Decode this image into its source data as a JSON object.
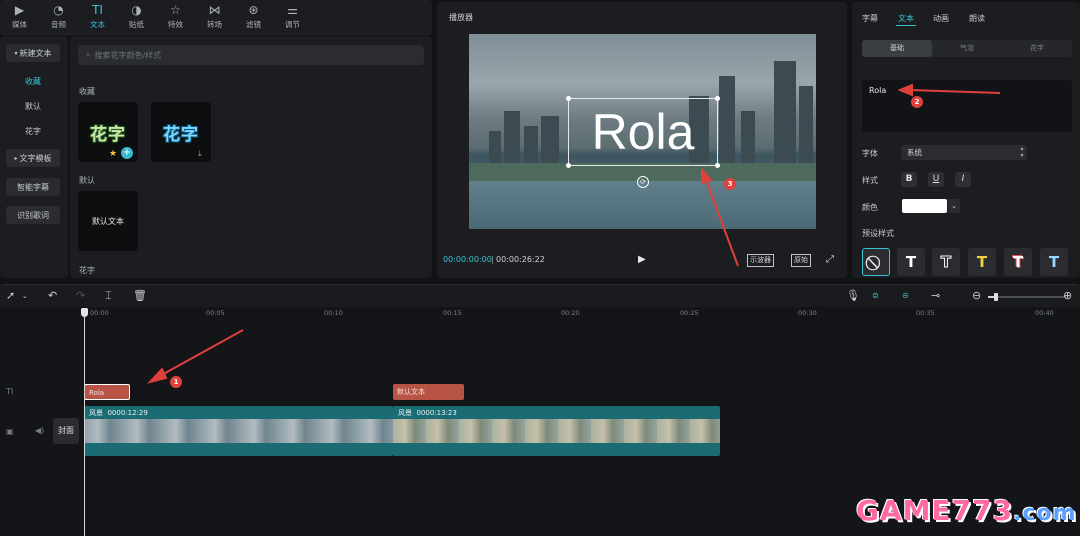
{
  "toolbar": {
    "items": [
      {
        "label": "媒体",
        "icon": "media-icon"
      },
      {
        "label": "音频",
        "icon": "audio-icon"
      },
      {
        "label": "文本",
        "icon": "text-icon"
      },
      {
        "label": "贴纸",
        "icon": "sticker-icon"
      },
      {
        "label": "特效",
        "icon": "effects-icon"
      },
      {
        "label": "转场",
        "icon": "transition-icon"
      },
      {
        "label": "滤镜",
        "icon": "filter-icon"
      },
      {
        "label": "调节",
        "icon": "adjust-icon"
      }
    ],
    "active_index": 2
  },
  "leftnav": {
    "items": [
      "新建文本",
      "收藏",
      "默认",
      "花字",
      "文字模板",
      "智能字幕",
      "识别歌词"
    ],
    "active": "收藏"
  },
  "assets": {
    "search_placeholder": "搜索花字颜色/样式",
    "section_favorites": "收藏",
    "tile1_text": "花字",
    "tile2_text": "花字",
    "section_default": "默认",
    "default_tile_text": "默认文本",
    "section_huazi": "花字"
  },
  "player": {
    "title": "播放器",
    "overlay_text": "Rola",
    "time_current": "00:00:00:00",
    "time_total": "00:00:26:22",
    "btn_scope": "示波器",
    "btn_original": "原始"
  },
  "inspector": {
    "tabs": [
      "字幕",
      "文本",
      "动画",
      "朗读"
    ],
    "active_tab": "文本",
    "subtabs": [
      "基础",
      "气泡",
      "花字"
    ],
    "active_subtab": "基础",
    "text_value": "Rola",
    "font_label": "字体",
    "font_value": "系统",
    "style_label": "样式",
    "style_bold": "B",
    "style_underline": "U",
    "style_italic": "I",
    "color_label": "颜色",
    "color_value": "#ffffff",
    "preset_label": "预设样式",
    "preset_letter": "T"
  },
  "timeline": {
    "ticks": [
      "00:00",
      "00:05",
      "00:10",
      "00:15",
      "00:20",
      "00:25",
      "00:30",
      "00:35",
      "00:40"
    ],
    "text_clip1": "Rola",
    "text_clip2": "默认文本",
    "video_clip1_name": "风景",
    "video_clip1_duration": "0000:12:29",
    "video_clip2_name": "风景",
    "video_clip2_duration": "0000:13:23",
    "cover_label": "封面"
  },
  "annotations": [
    "1",
    "2",
    "3"
  ],
  "watermark": {
    "main": "GAME773",
    "suffix": ".com"
  },
  "colors": {
    "accent": "#39c4d6",
    "text_clip": "#b85445",
    "video_clip": "#1b6b72",
    "annotation": "#e0403b"
  }
}
